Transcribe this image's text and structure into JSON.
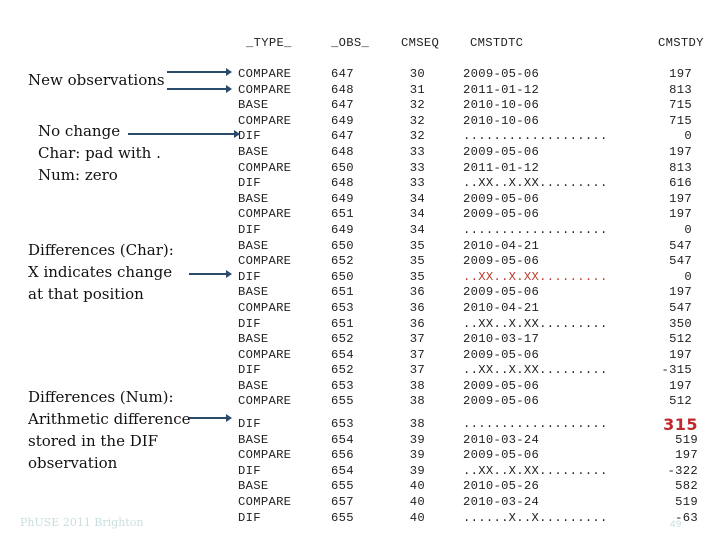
{
  "headers": {
    "type": "_TYPE_",
    "obs": "_OBS_",
    "cmseq": "CMSEQ",
    "cmstdtc": "CMSTDTC",
    "cmstdy": "CMSTDY"
  },
  "group1": [
    {
      "type": "COMPARE",
      "obs": "647",
      "cmseq": "30",
      "cmstdtc": "2009-05-06",
      "cmstdy": "197"
    },
    {
      "type": "COMPARE",
      "obs": "648",
      "cmseq": "31",
      "cmstdtc": "2011-01-12",
      "cmstdy": "813"
    },
    {
      "type": "BASE",
      "obs": "647",
      "cmseq": "32",
      "cmstdtc": "2010-10-06",
      "cmstdy": "715"
    },
    {
      "type": "COMPARE",
      "obs": "649",
      "cmseq": "32",
      "cmstdtc": "2010-10-06",
      "cmstdy": "715"
    },
    {
      "type": "DIF",
      "obs": "647",
      "cmseq": "32",
      "cmstdtc": "...................",
      "cmstdy": "0"
    },
    {
      "type": "BASE",
      "obs": "648",
      "cmseq": "33",
      "cmstdtc": "2009-05-06",
      "cmstdy": "197"
    },
    {
      "type": "COMPARE",
      "obs": "650",
      "cmseq": "33",
      "cmstdtc": "2011-01-12",
      "cmstdy": "813"
    },
    {
      "type": "DIF",
      "obs": "648",
      "cmseq": "33",
      "cmstdtc": "..XX..X.XX.........",
      "cmstdy": "616"
    },
    {
      "type": "BASE",
      "obs": "649",
      "cmseq": "34",
      "cmstdtc": "2009-05-06",
      "cmstdy": "197"
    },
    {
      "type": "COMPARE",
      "obs": "651",
      "cmseq": "34",
      "cmstdtc": "2009-05-06",
      "cmstdy": "197"
    },
    {
      "type": "DIF",
      "obs": "649",
      "cmseq": "34",
      "cmstdtc": "...................",
      "cmstdy": "0"
    },
    {
      "type": "BASE",
      "obs": "650",
      "cmseq": "35",
      "cmstdtc": "2010-04-21",
      "cmstdy": "547"
    },
    {
      "type": "COMPARE",
      "obs": "652",
      "cmseq": "35",
      "cmstdtc": "2009-05-06",
      "cmstdy": "547"
    },
    {
      "type": "DIF",
      "obs": "650",
      "cmseq": "35",
      "cmstdtc": "..XX..X.XX.........",
      "cmstdy": "0",
      "highlight": "dtc"
    },
    {
      "type": "BASE",
      "obs": "651",
      "cmseq": "36",
      "cmstdtc": "2009-05-06",
      "cmstdy": "197"
    },
    {
      "type": "COMPARE",
      "obs": "653",
      "cmseq": "36",
      "cmstdtc": "2010-04-21",
      "cmstdy": "547"
    },
    {
      "type": "DIF",
      "obs": "651",
      "cmseq": "36",
      "cmstdtc": "..XX..X.XX.........",
      "cmstdy": "350"
    },
    {
      "type": "BASE",
      "obs": "652",
      "cmseq": "37",
      "cmstdtc": "2010-03-17",
      "cmstdy": "512"
    },
    {
      "type": "COMPARE",
      "obs": "654",
      "cmseq": "37",
      "cmstdtc": "2009-05-06",
      "cmstdy": "197"
    },
    {
      "type": "DIF",
      "obs": "652",
      "cmseq": "37",
      "cmstdtc": "..XX..X.XX.........",
      "cmstdy": "-315"
    },
    {
      "type": "BASE",
      "obs": "653",
      "cmseq": "38",
      "cmstdtc": "2009-05-06",
      "cmstdy": "197"
    },
    {
      "type": "COMPARE",
      "obs": "655",
      "cmseq": "38",
      "cmstdtc": "2009-05-06",
      "cmstdy": "512"
    }
  ],
  "group2": [
    {
      "type": "DIF",
      "obs": "653",
      "cmseq": "38",
      "cmstdtc": "...................",
      "cmstdy": "315",
      "highlight": "dy"
    },
    {
      "type": "BASE",
      "obs": "654",
      "cmseq": "39",
      "cmstdtc": "2010-03-24",
      "cmstdy": "519"
    },
    {
      "type": "COMPARE",
      "obs": "656",
      "cmseq": "39",
      "cmstdtc": "2009-05-06",
      "cmstdy": "197"
    },
    {
      "type": "DIF",
      "obs": "654",
      "cmseq": "39",
      "cmstdtc": "..XX..X.XX.........",
      "cmstdy": "-322"
    },
    {
      "type": "BASE",
      "obs": "655",
      "cmseq": "40",
      "cmstdtc": "2010-05-26",
      "cmstdy": "582"
    },
    {
      "type": "COMPARE",
      "obs": "657",
      "cmseq": "40",
      "cmstdtc": "2010-03-24",
      "cmstdy": "519"
    },
    {
      "type": "DIF",
      "obs": "655",
      "cmseq": "40",
      "cmstdtc": "......X..X.........",
      "cmstdy": "-63"
    }
  ],
  "notes": {
    "new_obs": "New observations",
    "no_change": [
      "No change",
      "Char: pad with .",
      "Num: zero"
    ],
    "diff_char": [
      "Differences (Char):",
      "X indicates change",
      "at that position"
    ],
    "diff_num": [
      "Differences (Num):",
      "Arithmetic difference",
      "stored in the DIF",
      "observation"
    ]
  },
  "footer": "PhUSE 2011 Brighton",
  "page_number": "49",
  "colors": {
    "arrow": "#2c4a6b",
    "highlight": "#c0392b"
  }
}
